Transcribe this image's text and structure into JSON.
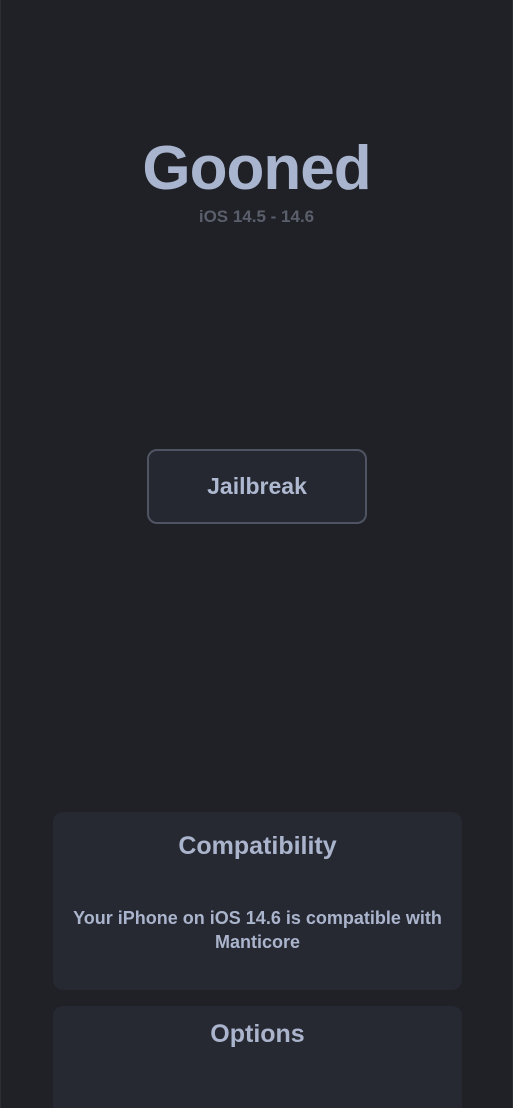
{
  "header": {
    "title": "Gooned",
    "subtitle": "iOS 14.5 - 14.6"
  },
  "actions": {
    "jailbreak_label": "Jailbreak"
  },
  "compatibility": {
    "title": "Compatibility",
    "message": "Your iPhone on iOS 14.6 is compatible with Manticore"
  },
  "options": {
    "title": "Options"
  }
}
